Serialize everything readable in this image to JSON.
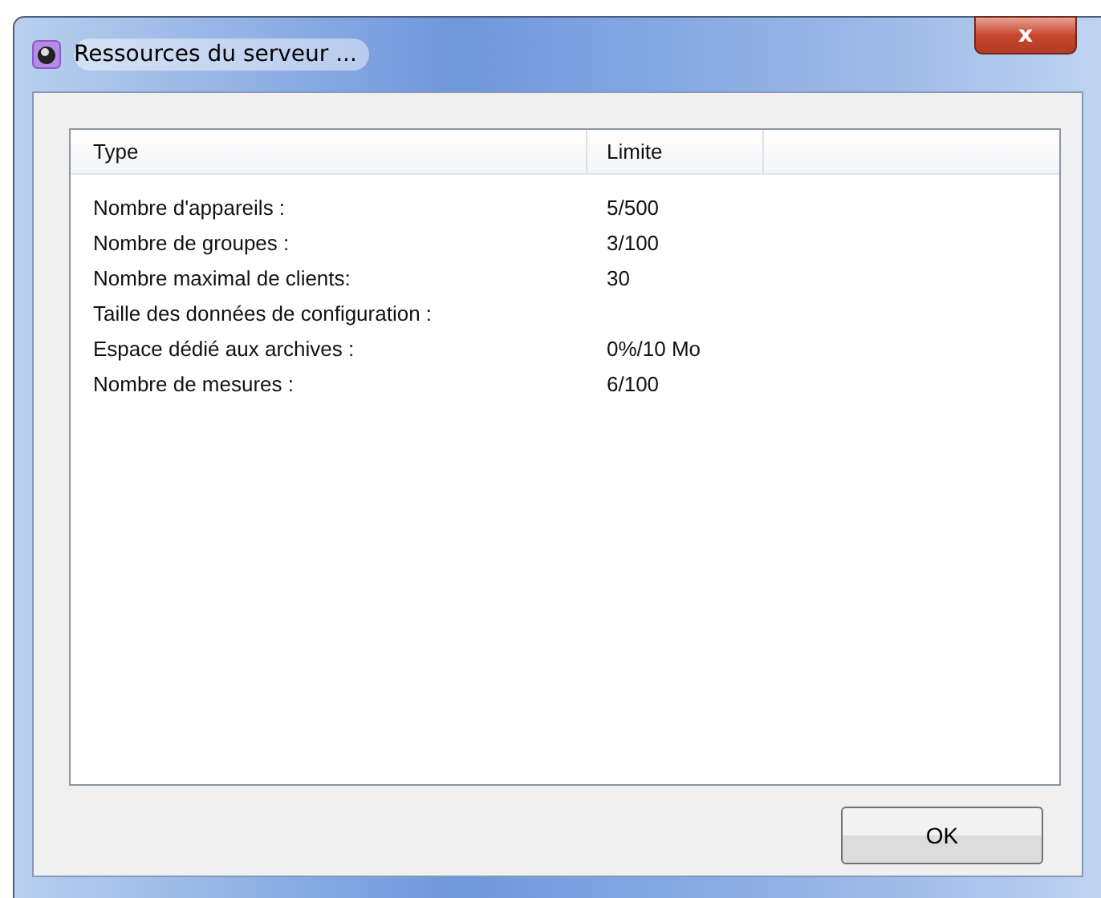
{
  "window": {
    "title": "Ressources du serveur ...",
    "close": "x"
  },
  "table": {
    "columns": [
      "Type",
      "Limite"
    ],
    "rows": [
      {
        "type": "Nombre d'appareils :",
        "limit": "5/500"
      },
      {
        "type": "Nombre de groupes :",
        "limit": "3/100"
      },
      {
        "type": "Nombre maximal de clients:",
        "limit": "30"
      },
      {
        "type": "Taille des données de configuration :",
        "limit": ""
      },
      {
        "type": "Espace dédié aux archives :",
        "limit": "0%/10 Mo"
      },
      {
        "type": "Nombre de mesures :",
        "limit": "6/100"
      }
    ]
  },
  "buttons": [
    "OK"
  ]
}
